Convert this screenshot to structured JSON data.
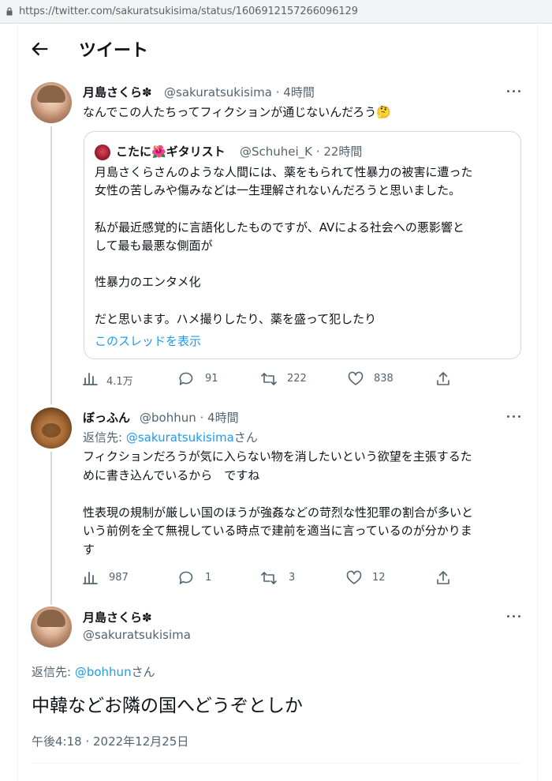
{
  "browser": {
    "url": "https://twitter.com/sakuratsukisima/status/1606912157266096129"
  },
  "header": {
    "title": "ツイート"
  },
  "tweet1": {
    "name": "月島さくら✽",
    "handle": "@sakuratsukisima",
    "time": "· 4時間",
    "text": "なんでこの人たちってフィクションが通じないんだろう🤔",
    "quote": {
      "name": "こたに🌺ギタリスト",
      "handle": "@Schuhei_K",
      "time": "· 22時間",
      "lines": [
        "月島さくらさんのような人間には、薬をもられて性暴力の被害に遭った",
        "女性の苦しみや傷みなどは一生理解されないんだろうと思いました。",
        "",
        "私が最近感覚的に言語化したものですが、AVによる社会への悪影響と",
        "して最も最悪な側面が",
        "",
        "性暴力のエンタメ化",
        "",
        "だと思います。ハメ撮りしたり、薬を盛って犯したり"
      ],
      "show_thread": "このスレッドを表示"
    },
    "stats": {
      "views": "4.1万",
      "replies": "91",
      "retweets": "222",
      "likes": "838"
    }
  },
  "tweet2": {
    "name": "ぼっふん",
    "handle": "@bohhun",
    "time": "· 4時間",
    "reply_label": "返信先:",
    "reply_handle": "@sakuratsukisima",
    "reply_suffix": "さん",
    "lines": [
      "フィクションだろうが気に入らない物を消したいという欲望を主張するた",
      "めに書き込んでいるから　ですね",
      "",
      "性表現の規制が厳しい国のほうが強姦などの苛烈な性犯罪の割合が多いと",
      "いう前例を全て無視している時点で建前を適当に言っているのが分かりま",
      "す"
    ],
    "stats": {
      "views": "987",
      "replies": "1",
      "retweets": "3",
      "likes": "12"
    }
  },
  "tweet3": {
    "name": "月島さくら✽",
    "handle": "@sakuratsukisima",
    "reply_label": "返信先:",
    "reply_handle": "@bohhun",
    "reply_suffix": "さん",
    "text": "中韓などお隣の国へどうぞとしか",
    "timestamp": "午後4:18 · 2022年12月25日"
  },
  "colors": {
    "text": "#0f1419",
    "secondary": "#536471",
    "link": "#1d9bf0",
    "border": "#cfd9de"
  }
}
